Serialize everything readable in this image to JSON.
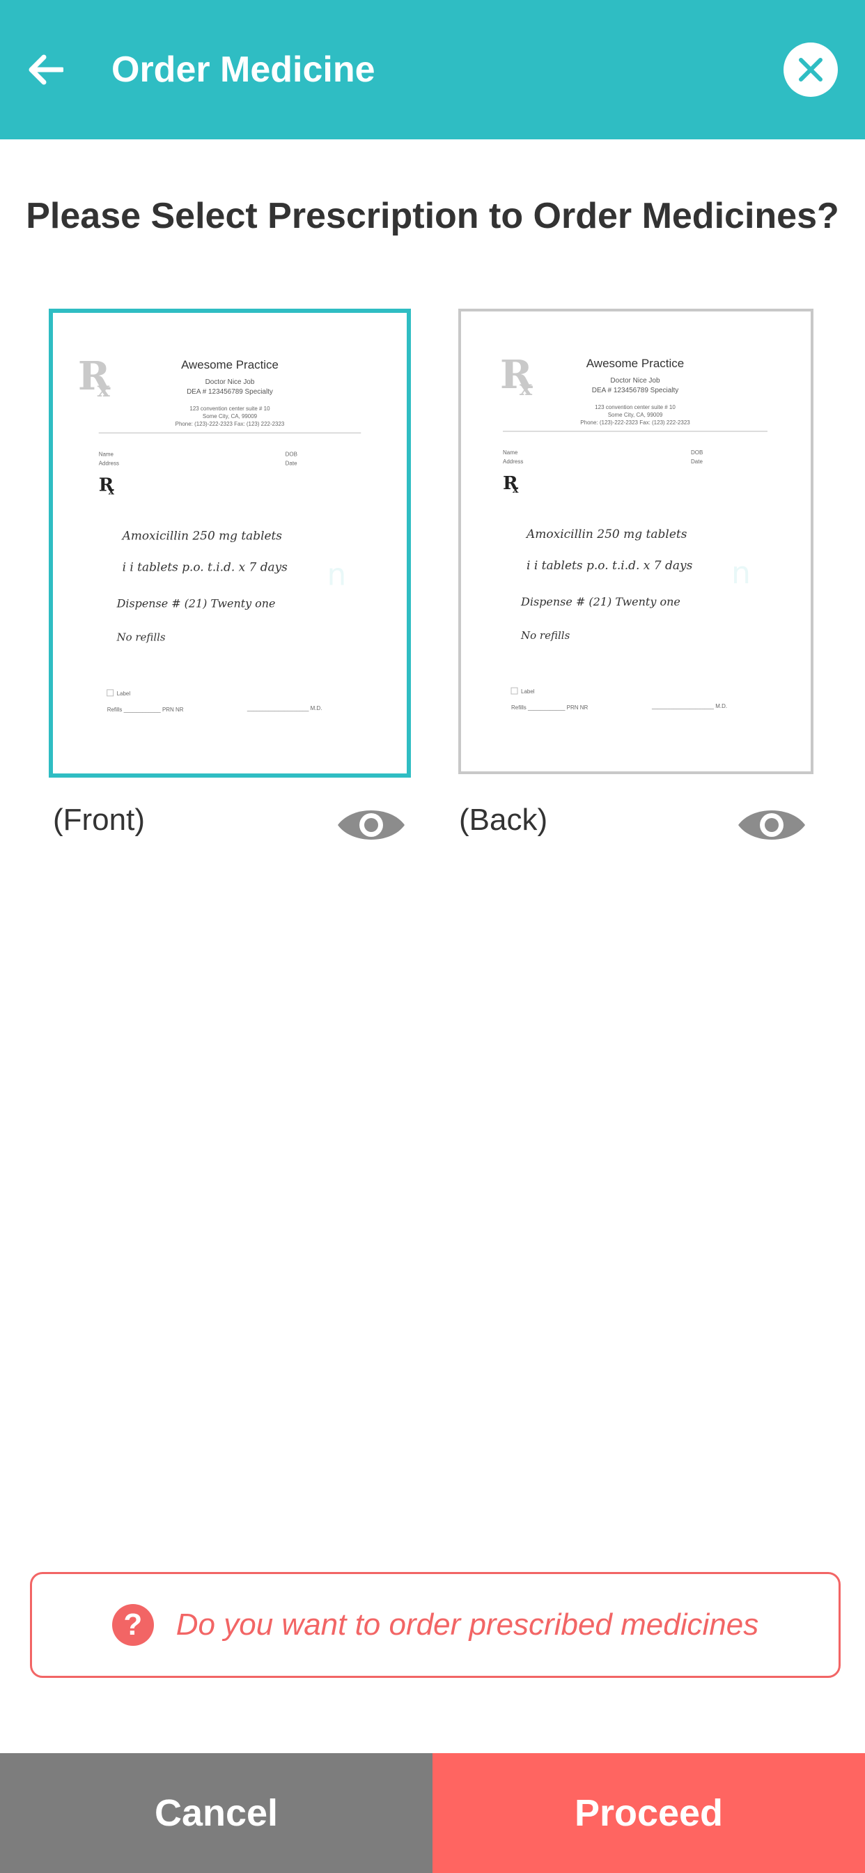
{
  "header": {
    "title": "Order Medicine"
  },
  "heading": "Please Select Prescription to Order Medicines?",
  "prescription": {
    "practice": "Awesome Practice",
    "doctor": "Doctor Nice Job",
    "dea": "DEA # 123456789 Specialty",
    "address1": "123 convention center suite # 10",
    "address2": "Some City, CA, 99009",
    "phone": "Phone: (123)-222-2323  Fax: (123) 222-2323",
    "name_label": "Name",
    "address_label": "Address",
    "dob_label": "DOB",
    "date_label": "Date",
    "rx_line1": "Amoxicillin  250 mg  tablets",
    "rx_line2": "i i  tablets  p.o.  t.i.d.  x 7 days",
    "rx_line3": "Dispense #  (21)  Twenty one",
    "rx_line4": "No refills",
    "label_check": "Label",
    "refills": "Refills ____________  PRN  NR",
    "md": "____________________ M.D."
  },
  "cards": [
    {
      "side": "(Front)",
      "selected": true
    },
    {
      "side": "(Back)",
      "selected": false
    }
  ],
  "notice": {
    "text": "Do you want to order prescribed medicines"
  },
  "actions": {
    "cancel": "Cancel",
    "proceed": "Proceed"
  },
  "colors": {
    "primary": "#2fbdc3",
    "accent": "#ff6561",
    "neutral": "#7d7d7d"
  }
}
